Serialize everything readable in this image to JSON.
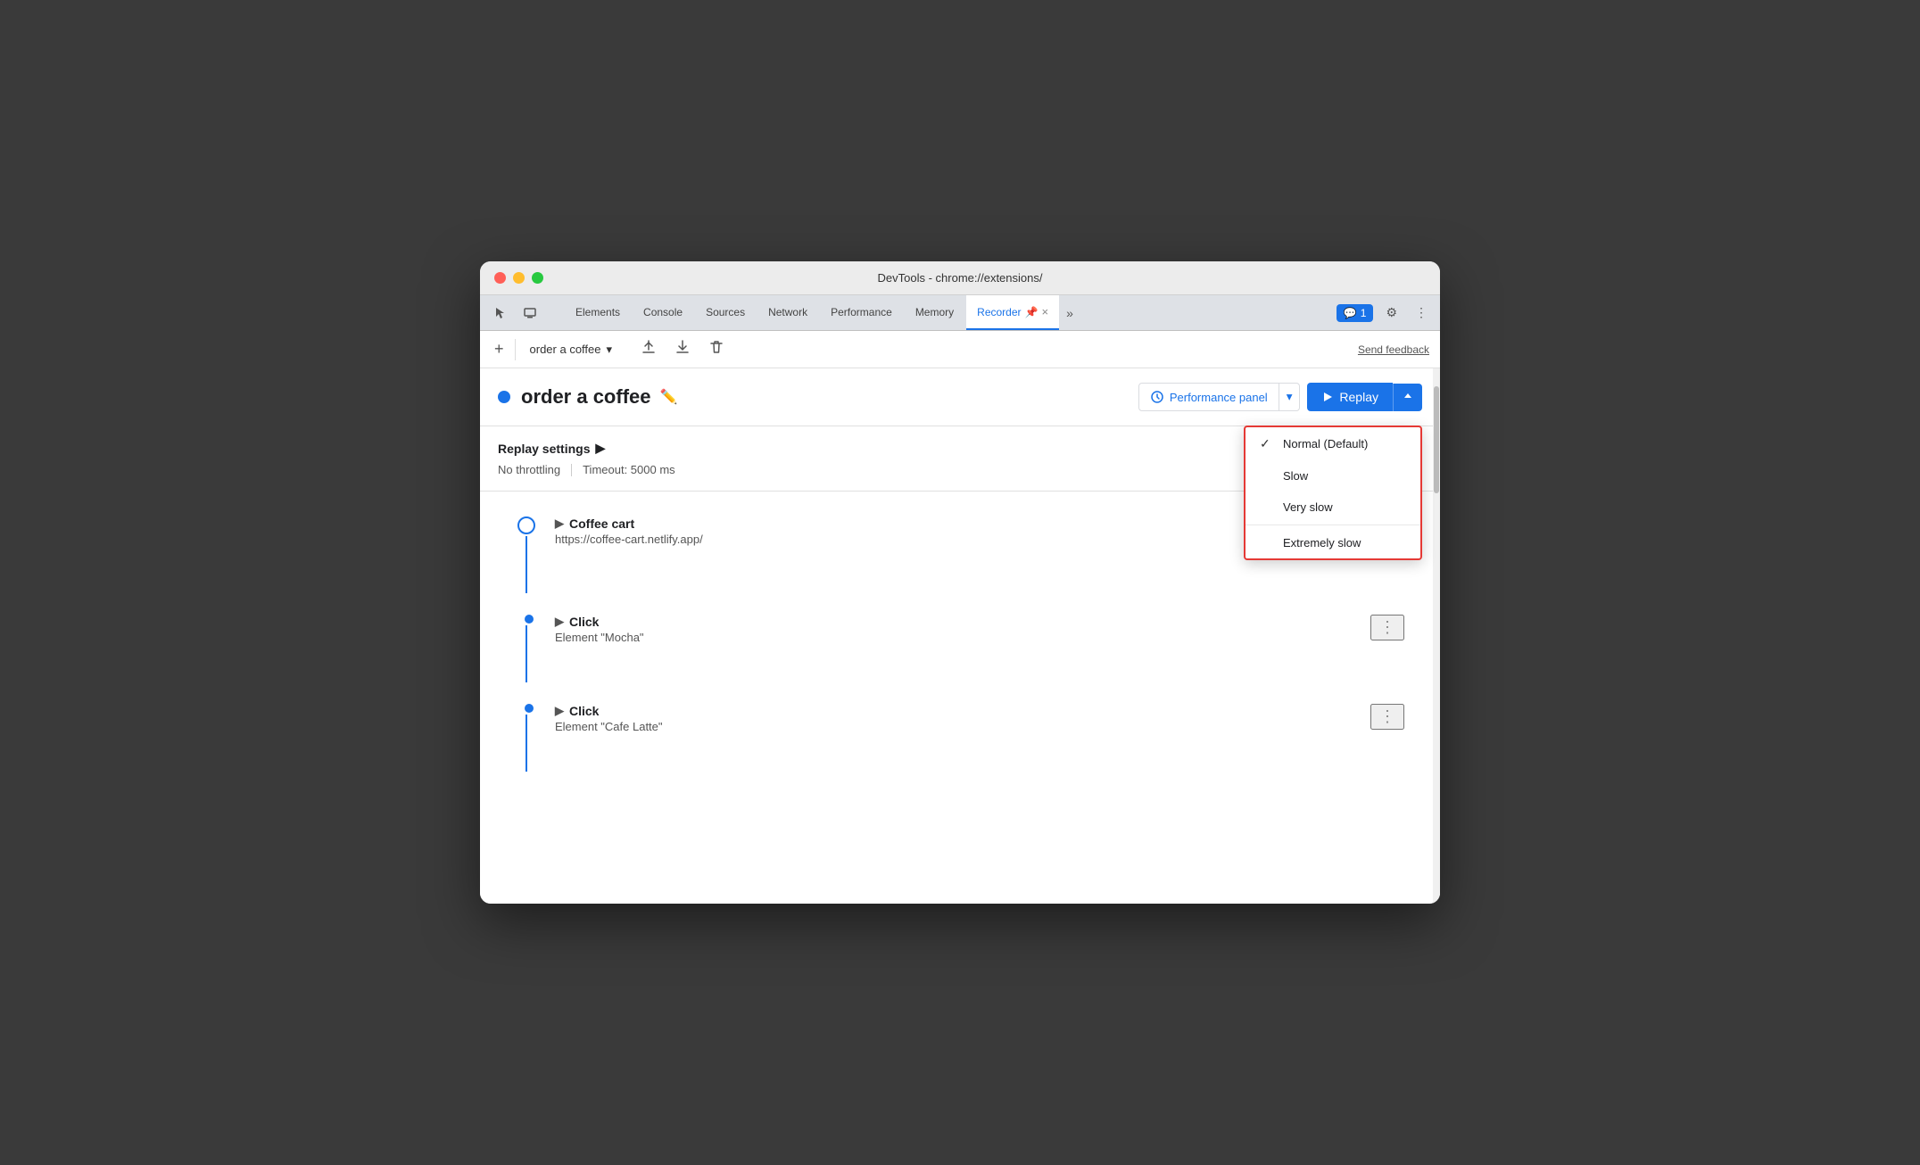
{
  "window": {
    "title": "DevTools - chrome://extensions/"
  },
  "tabs": {
    "items": [
      {
        "id": "elements",
        "label": "Elements"
      },
      {
        "id": "console",
        "label": "Console"
      },
      {
        "id": "sources",
        "label": "Sources"
      },
      {
        "id": "network",
        "label": "Network"
      },
      {
        "id": "performance",
        "label": "Performance"
      },
      {
        "id": "memory",
        "label": "Memory"
      },
      {
        "id": "recorder",
        "label": "Recorder",
        "active": true
      }
    ],
    "more_icon": "»",
    "chat_label": "1",
    "settings_icon": "⚙",
    "more_options_icon": "⋮"
  },
  "toolbar": {
    "plus_label": "+",
    "recording_name": "order a coffee",
    "dropdown_icon": "▾",
    "export_icon": "↑",
    "import_icon": "↓",
    "delete_icon": "🗑",
    "send_feedback": "Send feedback"
  },
  "recording": {
    "title": "order a coffee",
    "dot_color": "#1a73e8"
  },
  "header_actions": {
    "performance_panel_label": "Performance panel",
    "performance_icon": "↻",
    "dropdown_arrow": "▾",
    "replay_label": "Replay",
    "replay_icon": "▶",
    "replay_dropdown_icon": "▲"
  },
  "replay_settings": {
    "title": "Replay settings",
    "arrow": "▶",
    "throttling": "No throttling",
    "timeout": "Timeout: 5000 ms"
  },
  "dropdown_menu": {
    "items": [
      {
        "id": "normal",
        "label": "Normal (Default)",
        "selected": true
      },
      {
        "id": "slow",
        "label": "Slow",
        "selected": false
      },
      {
        "id": "very-slow",
        "label": "Very slow",
        "selected": false
      },
      {
        "id": "extremely-slow",
        "label": "Extremely slow",
        "selected": false
      }
    ]
  },
  "steps": [
    {
      "id": "coffee-cart",
      "type": "navigate",
      "title": "Coffee cart",
      "subtitle": "https://coffee-cart.netlify.app/",
      "circle_type": "outline"
    },
    {
      "id": "click-mocha",
      "type": "click",
      "title": "Click",
      "subtitle": "Element \"Mocha\"",
      "circle_type": "filled"
    },
    {
      "id": "click-latte",
      "type": "click",
      "title": "Click",
      "subtitle": "Element \"Cafe Latte\"",
      "circle_type": "filled"
    }
  ]
}
